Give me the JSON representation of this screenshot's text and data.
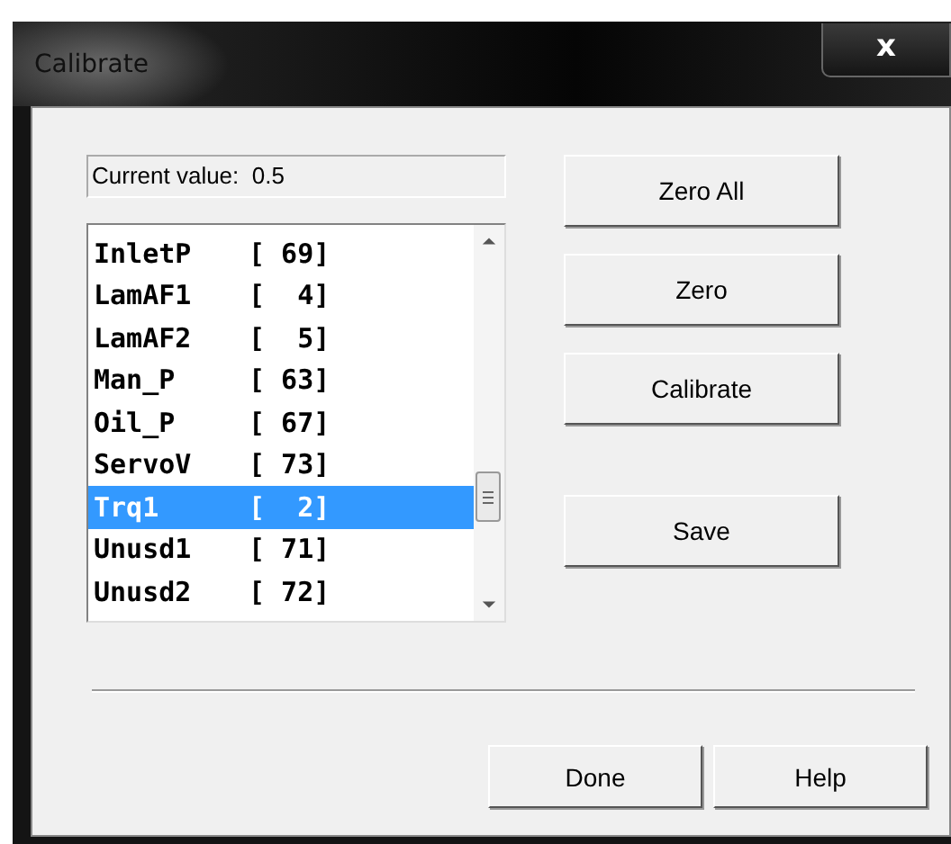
{
  "window": {
    "title": "Calibrate",
    "close": "x"
  },
  "current_value": "Current value:  0.5",
  "channels": [
    {
      "name": "InletP",
      "value": "[ 69]",
      "selected": false
    },
    {
      "name": "LamAF1",
      "value": "[  4]",
      "selected": false
    },
    {
      "name": "LamAF2",
      "value": "[  5]",
      "selected": false
    },
    {
      "name": "Man_P",
      "value": "[ 63]",
      "selected": false
    },
    {
      "name": "Oil_P",
      "value": "[ 67]",
      "selected": false
    },
    {
      "name": "ServoV",
      "value": "[ 73]",
      "selected": false
    },
    {
      "name": "Trq1",
      "value": "[  2]",
      "selected": true
    },
    {
      "name": "Unusd1",
      "value": "[ 71]",
      "selected": false
    },
    {
      "name": "Unusd2",
      "value": "[ 72]",
      "selected": false
    }
  ],
  "actions": [
    "Zero All",
    "Zero",
    "Calibrate",
    "Save"
  ],
  "buttons": [
    "Done",
    "Help"
  ]
}
